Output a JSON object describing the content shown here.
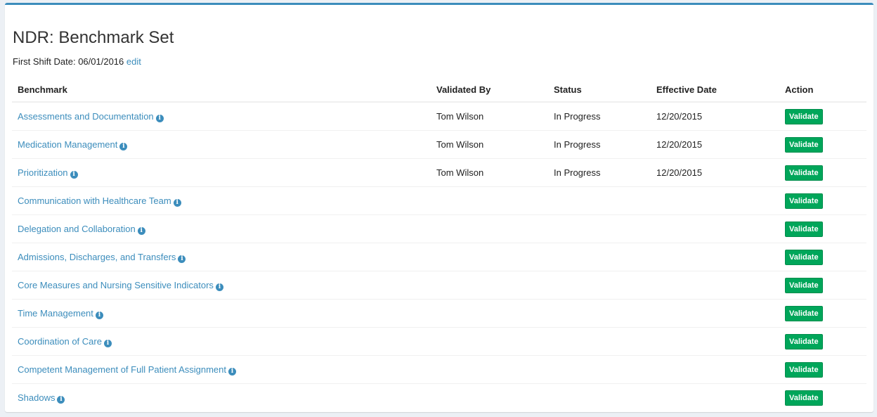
{
  "page": {
    "title": "NDR: Benchmark Set",
    "shift_label": "First Shift Date: 06/01/2016",
    "edit_label": "edit"
  },
  "table": {
    "headers": [
      "Benchmark",
      "Validated By",
      "Status",
      "Effective Date",
      "Action"
    ],
    "rows": [
      {
        "benchmark": "Assessments and Documentation",
        "validated_by": "Tom Wilson",
        "status": "In Progress",
        "effective_date": "12/20/2015",
        "action": "Validate"
      },
      {
        "benchmark": "Medication Management",
        "validated_by": "Tom Wilson",
        "status": "In Progress",
        "effective_date": "12/20/2015",
        "action": "Validate"
      },
      {
        "benchmark": "Prioritization",
        "validated_by": "Tom Wilson",
        "status": "In Progress",
        "effective_date": "12/20/2015",
        "action": "Validate"
      },
      {
        "benchmark": "Communication with Healthcare Team",
        "validated_by": "",
        "status": "",
        "effective_date": "",
        "action": "Validate"
      },
      {
        "benchmark": "Delegation and Collaboration",
        "validated_by": "",
        "status": "",
        "effective_date": "",
        "action": "Validate"
      },
      {
        "benchmark": "Admissions, Discharges, and Transfers",
        "validated_by": "",
        "status": "",
        "effective_date": "",
        "action": "Validate"
      },
      {
        "benchmark": "Core Measures and Nursing Sensitive Indicators",
        "validated_by": "",
        "status": "",
        "effective_date": "",
        "action": "Validate"
      },
      {
        "benchmark": "Time Management",
        "validated_by": "",
        "status": "",
        "effective_date": "",
        "action": "Validate"
      },
      {
        "benchmark": "Coordination of Care",
        "validated_by": "",
        "status": "",
        "effective_date": "",
        "action": "Validate"
      },
      {
        "benchmark": "Competent Management of Full Patient Assignment",
        "validated_by": "",
        "status": "",
        "effective_date": "",
        "action": "Validate"
      },
      {
        "benchmark": "Shadows",
        "validated_by": "",
        "status": "",
        "effective_date": "",
        "action": "Validate"
      }
    ]
  },
  "icons": {
    "info": "info-circle-icon"
  },
  "colors": {
    "accent": "#3c8dbc",
    "validate_button": "#00a65a"
  }
}
